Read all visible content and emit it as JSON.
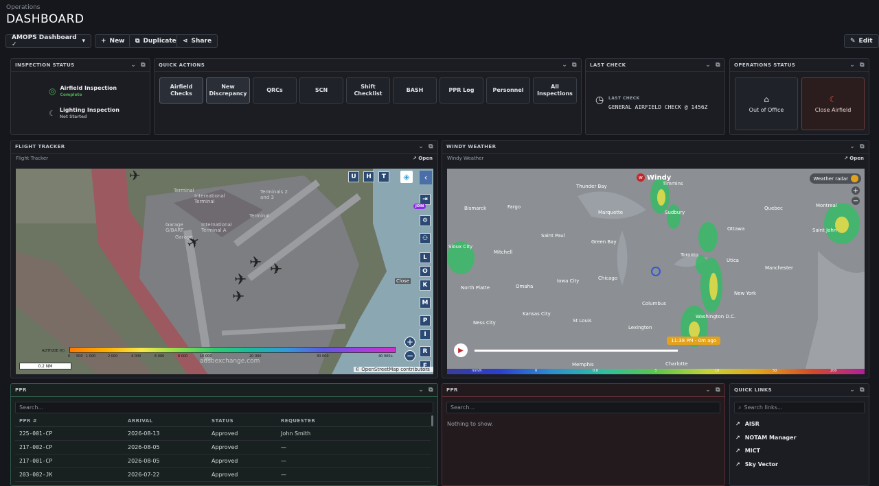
{
  "header": {
    "section": "Operations",
    "title": "DASHBOARD"
  },
  "toolbar": {
    "dashboard_select": "AMOPS Dashboard ✓",
    "new": "New",
    "duplicate": "Duplicate",
    "share": "Share",
    "edit": "Edit"
  },
  "inspection_status": {
    "title": "INSPECTION STATUS",
    "items": [
      {
        "name": "Airfield Inspection",
        "status": "Complete"
      },
      {
        "name": "Lighting Inspection",
        "status": "Not Started"
      }
    ]
  },
  "quick_actions": {
    "title": "QUICK ACTIONS",
    "buttons": [
      "Airfield Checks",
      "New Discrepancy",
      "QRCs",
      "SCN",
      "Shift Checklist",
      "BASH",
      "PPR Log",
      "Personnel",
      "All Inspections"
    ]
  },
  "last_check": {
    "title": "LAST CHECK",
    "label": "LAST CHECK",
    "value": "GENERAL AIRFIELD CHECK @ 1456Z"
  },
  "operations_status": {
    "title": "OPERATIONS STATUS",
    "out_of_office": "Out of Office",
    "close_airfield": "Close Airfield"
  },
  "flight_tracker": {
    "title": "FLIGHT TRACKER",
    "frame_label": "Flight Tracker",
    "open": "Open",
    "side_buttons": [
      "U",
      "H",
      "T"
    ],
    "join": "JOIN",
    "letter_buttons": [
      "L",
      "O",
      "K",
      "M",
      "P",
      "I",
      "R",
      "F"
    ],
    "close": "Close",
    "altitude_label": "ALTITUDE (ft)",
    "altitude_ticks": [
      "0",
      "500",
      "1 000",
      "2 000",
      "4 000",
      "6 000",
      "8 000",
      "10 000",
      "20 000",
      "30 000",
      "40 000+"
    ],
    "scale": "0.2 NM",
    "watermark": "adsbexchange.com",
    "attribution": "© OpenStreetMap contributors",
    "map_labels": [
      "Terminal",
      "International Terminal",
      "Terminals 2 and 3",
      "Terminal",
      "International Terminal A",
      "Garage G/BART",
      "Garage"
    ]
  },
  "windy": {
    "title": "WINDY WEATHER",
    "frame_label": "Windy Weather",
    "open": "Open",
    "brand": "Windy",
    "layer": "Weather radar",
    "time": "11:38 PM - 0m ago",
    "scale_unit": "mm/h",
    "scale_ticks": [
      "0",
      "0.8",
      "3",
      "10",
      "50",
      "200"
    ],
    "cities": [
      "Thunder Bay",
      "Timmins",
      "Bismarck",
      "Fargo",
      "Marquette",
      "Sudbury",
      "Quebec",
      "Montreal",
      "Saint John",
      "Ottawa",
      "Saint Paul",
      "Green Bay",
      "Mitchell",
      "Toronto",
      "Utica",
      "Manchester",
      "Sioux City",
      "Chicago",
      "Columbus",
      "North Platte",
      "Omaha",
      "Iowa City",
      "New York",
      "Kansas City",
      "St Louis",
      "Washington D.C.",
      "Ness City",
      "Lexington",
      "Charlotte",
      "Memphis"
    ]
  },
  "ppr_table": {
    "title": "PPR",
    "search_placeholder": "Search...",
    "columns": [
      "PPR #",
      "ARRIVAL",
      "STATUS",
      "REQUESTER"
    ],
    "rows": [
      [
        "225-001-CP",
        "2026-08-13",
        "Approved",
        "John Smith"
      ],
      [
        "217-002-CP",
        "2026-08-05",
        "Approved",
        "—"
      ],
      [
        "217-001-CP",
        "2026-08-05",
        "Approved",
        "—"
      ],
      [
        "203-002-JK",
        "2026-07-22",
        "Approved",
        "—"
      ]
    ]
  },
  "ppr_empty": {
    "title": "PPR",
    "search_placeholder": "Search...",
    "empty": "Nothing to show."
  },
  "quick_links": {
    "title": "QUICK LINKS",
    "search_placeholder": "Search links...",
    "links": [
      "AISR",
      "NOTAM Manager",
      "MICT",
      "Sky Vector"
    ]
  }
}
